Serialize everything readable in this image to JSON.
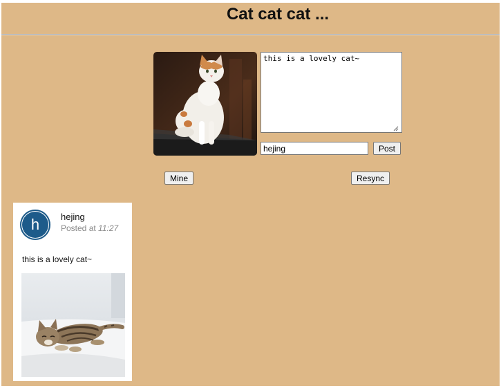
{
  "header": {
    "title": "Cat cat cat ..."
  },
  "composer": {
    "text_value": "this is a lovely cat~",
    "name_value": "hejing",
    "post_label": "Post"
  },
  "controls": {
    "mine_label": "Mine",
    "resync_label": "Resync"
  },
  "feed": [
    {
      "avatar_letter": "h",
      "author": "hejing",
      "posted_prefix": "Posted at",
      "time": "11:27",
      "text": "this is a lovely cat~"
    }
  ],
  "colors": {
    "background": "#deb887",
    "avatar": "#1d5b8a",
    "card": "#ffffff"
  }
}
